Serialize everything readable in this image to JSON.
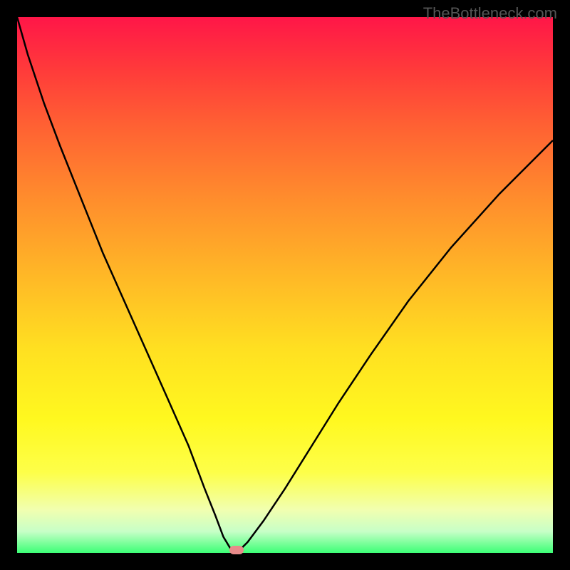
{
  "watermark": "TheBottleneck.com",
  "chart_data": {
    "type": "line",
    "title": "",
    "xlabel": "",
    "ylabel": "",
    "xlim": [
      0,
      100
    ],
    "ylim": [
      0,
      100
    ],
    "series": [
      {
        "name": "bottleneck-curve",
        "x": [
          0,
          2,
          5,
          8,
          12,
          16,
          20,
          24,
          28,
          32,
          35,
          37,
          38.5,
          40,
          41.5,
          43,
          46,
          50,
          55,
          60,
          66,
          73,
          81,
          90,
          100
        ],
        "y": [
          100,
          93,
          84,
          76,
          66,
          56,
          47,
          38,
          29,
          20,
          12,
          7,
          3,
          0.5,
          0.5,
          2,
          6,
          12,
          20,
          28,
          37,
          47,
          57,
          67,
          77
        ]
      }
    ],
    "marker": {
      "x": 41,
      "y": 0.5,
      "color": "#e88a8a"
    },
    "gradient_stops": [
      {
        "pos": 0,
        "color": "#ff1648"
      },
      {
        "pos": 10,
        "color": "#ff3b3a"
      },
      {
        "pos": 20,
        "color": "#ff6033"
      },
      {
        "pos": 33,
        "color": "#ff8a2d"
      },
      {
        "pos": 47,
        "color": "#ffb427"
      },
      {
        "pos": 62,
        "color": "#ffe021"
      },
      {
        "pos": 75,
        "color": "#fff81f"
      },
      {
        "pos": 85,
        "color": "#fdff49"
      },
      {
        "pos": 92,
        "color": "#f1ffb0"
      },
      {
        "pos": 96,
        "color": "#c7ffc7"
      },
      {
        "pos": 100,
        "color": "#3dff76"
      }
    ]
  }
}
